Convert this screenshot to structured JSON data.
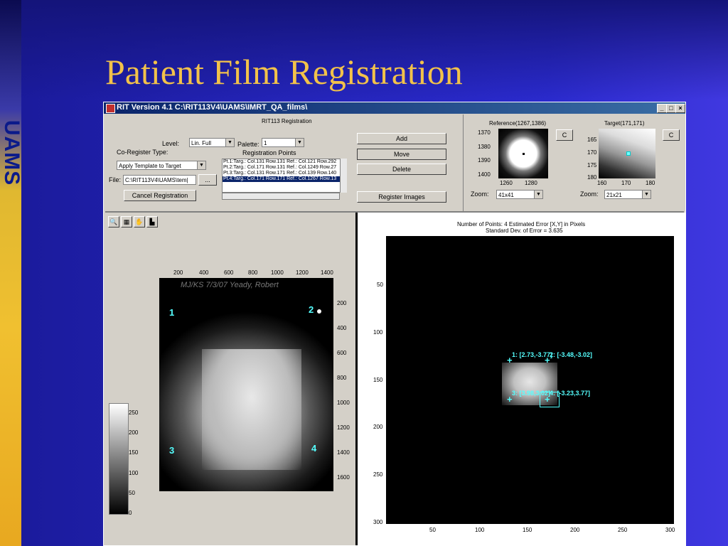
{
  "slide": {
    "title": "Patient Film Registration",
    "logo": "UAMS"
  },
  "window": {
    "title": "RIT Version 4.1 C:\\RIT113V4\\UAMS\\IMRT_QA_films\\",
    "minimize": "_",
    "maximize": "□",
    "close": "×"
  },
  "panel": {
    "heading": "RIT113 Registration",
    "level_label": "Level:",
    "level_value": "Lin. Full",
    "palette_label": "Palette:",
    "palette_value": "1",
    "coreg_label": "Co-Register Type:",
    "coreg_value": "Apply Template to Target",
    "file_label": "File:",
    "file_value": "C:\\RIT113V4\\UAMS\\tem|",
    "browse_label": "...",
    "cancel_label": "Cancel Registration",
    "points_label": "Registration Points",
    "points": [
      "Pt.1:Targ.: Col.131 Row.131   Ref.: Col.121 Row.292",
      "Pt.2:Targ.: Col.171 Row.131   Ref.: Col.1249 Row.27",
      "Pt.3:Targ.: Col.131 Row.171   Ref.: Col.139 Row.140",
      "Pt.4:Targ.: Col.171 Row.171   Ref.: Col.1267 Row.13"
    ],
    "add_label": "Add",
    "move_label": "Move",
    "delete_label": "Delete",
    "register_label": "Register Images"
  },
  "reference": {
    "title": "Reference(1267,1386)",
    "c_label": "C",
    "y_ticks": [
      "1370",
      "1380",
      "1390",
      "1400"
    ],
    "x_ticks": [
      "1260",
      "1280"
    ],
    "zoom_label": "Zoom:",
    "zoom_value": "41x41"
  },
  "target": {
    "title": "Target(171,171)",
    "c_label": "C",
    "y_ticks": [
      "165",
      "170",
      "175",
      "180"
    ],
    "x_ticks": [
      "160",
      "170",
      "180"
    ],
    "zoom_label": "Zoom:",
    "zoom_value": "21x21"
  },
  "left_view": {
    "toolbar": [
      "zoom-icon",
      "grid-icon",
      "pan-hand-icon",
      "histogram-icon"
    ],
    "x_ticks": [
      "200",
      "400",
      "600",
      "800",
      "1000",
      "1200",
      "1400"
    ],
    "y_ticks": [
      "200",
      "400",
      "600",
      "800",
      "1000",
      "1200",
      "1400",
      "1600"
    ],
    "annotation": "MJ/KS   7/3/07   Yeady, Robert",
    "markers": [
      "1",
      "2",
      "3",
      "4"
    ],
    "colorbar_ticks": [
      "250",
      "200",
      "150",
      "100",
      "50",
      "0"
    ]
  },
  "right_view": {
    "info_line1": "Number of Points: 4  Estimated Error [X,Y] in Pixels",
    "info_line2": "Standard Dev. of Error =  3.635",
    "y_ticks": [
      "50",
      "100",
      "150",
      "200",
      "250",
      "300"
    ],
    "x_ticks": [
      "50",
      "100",
      "150",
      "200",
      "250",
      "300"
    ],
    "point_labels": [
      "1: [2.73,-3.77]",
      "2: [-3.48,-3.02]",
      "3: [3.98,3.02]",
      "4: [-3.23,3.77]"
    ]
  }
}
